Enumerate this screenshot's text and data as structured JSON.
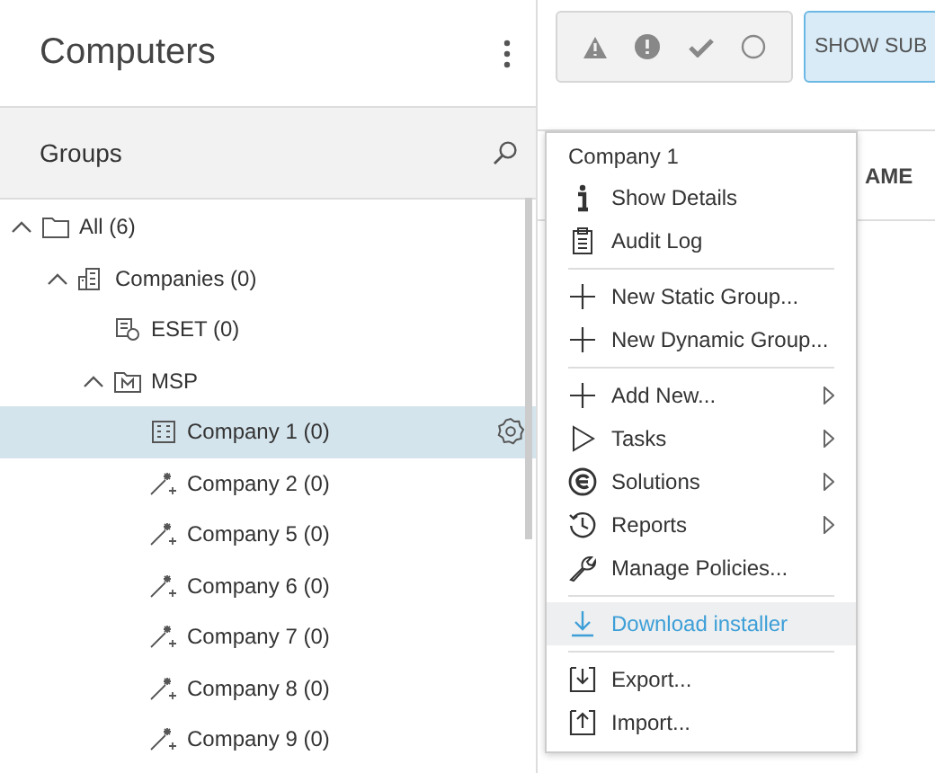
{
  "panel": {
    "title": "Computers",
    "groups_label": "Groups"
  },
  "tree": [
    {
      "label": "All (6)",
      "kind": "folder",
      "expanded": true,
      "selected": false,
      "children": [
        {
          "label": "Companies (0)",
          "kind": "companies",
          "expanded": true,
          "selected": false,
          "children": [
            {
              "label": "ESET (0)",
              "kind": "company-user",
              "selected": false
            },
            {
              "label": "MSP",
              "kind": "msp",
              "expanded": true,
              "selected": false,
              "children": [
                {
                  "label": "Company 1 (0)",
                  "kind": "building",
                  "selected": true
                },
                {
                  "label": "Company 2 (0)",
                  "kind": "dynamic",
                  "selected": false
                },
                {
                  "label": "Company 5 (0)",
                  "kind": "dynamic",
                  "selected": false
                },
                {
                  "label": "Company 6 (0)",
                  "kind": "dynamic",
                  "selected": false
                },
                {
                  "label": "Company 7 (0)",
                  "kind": "dynamic",
                  "selected": false
                },
                {
                  "label": "Company 8 (0)",
                  "kind": "dynamic",
                  "selected": false
                },
                {
                  "label": "Company 9 (0)",
                  "kind": "dynamic",
                  "selected": false
                }
              ]
            }
          ]
        }
      ]
    }
  ],
  "toolbar": {
    "show_button": "SHOW SUB",
    "column_header": "AME"
  },
  "menu": {
    "title": "Company 1",
    "sections": [
      [
        {
          "label": "Show Details",
          "kind": "info",
          "submenu": false,
          "selected": false
        },
        {
          "label": "Audit Log",
          "kind": "clipboard",
          "submenu": false,
          "selected": false
        }
      ],
      [
        {
          "label": "New Static Group...",
          "kind": "plus",
          "submenu": false,
          "selected": false
        },
        {
          "label": "New Dynamic Group...",
          "kind": "plus",
          "submenu": false,
          "selected": false
        }
      ],
      [
        {
          "label": "Add New...",
          "kind": "plus",
          "submenu": true,
          "selected": false
        },
        {
          "label": "Tasks",
          "kind": "play",
          "submenu": true,
          "selected": false
        },
        {
          "label": "Solutions",
          "kind": "eset",
          "submenu": true,
          "selected": false
        },
        {
          "label": "Reports",
          "kind": "clock",
          "submenu": true,
          "selected": false
        },
        {
          "label": "Manage Policies...",
          "kind": "wrench",
          "submenu": false,
          "selected": false
        }
      ],
      [
        {
          "label": "Download installer",
          "kind": "download",
          "submenu": false,
          "selected": true
        }
      ],
      [
        {
          "label": "Export...",
          "kind": "export",
          "submenu": false,
          "selected": false
        },
        {
          "label": "Import...",
          "kind": "import",
          "submenu": false,
          "selected": false
        }
      ]
    ]
  }
}
